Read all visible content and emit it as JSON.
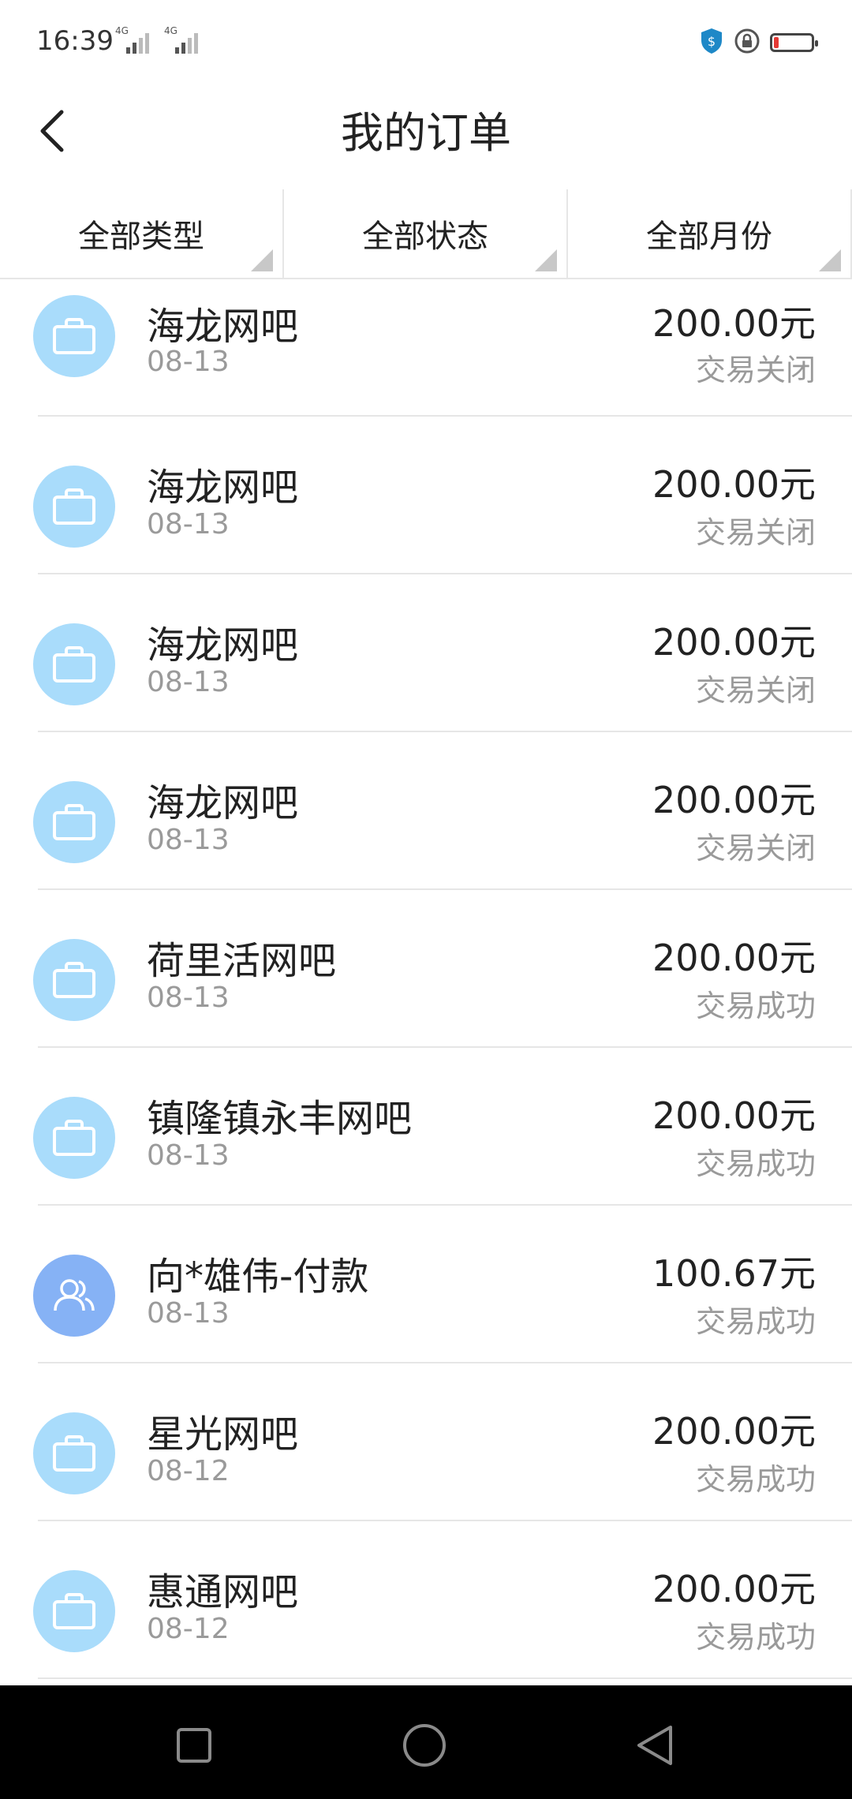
{
  "status_bar": {
    "time": "16:39",
    "signal1_label": "4G",
    "signal2_label": "4G",
    "icons": [
      "vpn-shield-icon",
      "lock-rotation-icon",
      "battery-low-icon"
    ],
    "battery_color": "#e53935"
  },
  "header": {
    "title": "我的订单",
    "back_icon": "chevron-left-icon"
  },
  "filters": [
    {
      "label": "全部类型"
    },
    {
      "label": "全部状态"
    },
    {
      "label": "全部月份"
    }
  ],
  "orders": [
    {
      "name": "海龙网吧",
      "date": "08-13",
      "amount": "200.00元",
      "status": "交易关闭",
      "icon": "shopping-bag-icon"
    },
    {
      "name": "海龙网吧",
      "date": "08-13",
      "amount": "200.00元",
      "status": "交易关闭",
      "icon": "shopping-bag-icon"
    },
    {
      "name": "海龙网吧",
      "date": "08-13",
      "amount": "200.00元",
      "status": "交易关闭",
      "icon": "shopping-bag-icon"
    },
    {
      "name": "海龙网吧",
      "date": "08-13",
      "amount": "200.00元",
      "status": "交易关闭",
      "icon": "shopping-bag-icon"
    },
    {
      "name": "荷里活网吧",
      "date": "08-13",
      "amount": "200.00元",
      "status": "交易成功",
      "icon": "shopping-bag-icon"
    },
    {
      "name": "镇隆镇永丰网吧",
      "date": "08-13",
      "amount": "200.00元",
      "status": "交易成功",
      "icon": "shopping-bag-icon"
    },
    {
      "name": "向*雄伟-付款",
      "date": "08-13",
      "amount": "100.67元",
      "status": "交易成功",
      "icon": "people-icon"
    },
    {
      "name": "星光网吧",
      "date": "08-12",
      "amount": "200.00元",
      "status": "交易成功",
      "icon": "shopping-bag-icon"
    },
    {
      "name": "惠通网吧",
      "date": "08-12",
      "amount": "200.00元",
      "status": "交易成功",
      "icon": "shopping-bag-icon"
    }
  ],
  "colors": {
    "bag_avatar": "#a9dcfb",
    "person_avatar": "#86b2f5",
    "secondary_text": "#9a9a9a"
  },
  "nav_bar": {
    "buttons": [
      "recent-apps-icon",
      "home-icon",
      "back-triangle-icon"
    ]
  }
}
